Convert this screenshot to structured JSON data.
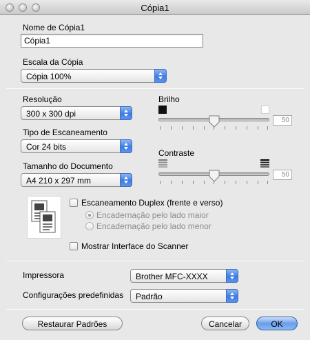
{
  "window": {
    "title": "Cópia1"
  },
  "copy_name": {
    "label": "Nome de Cópia1",
    "value": "Cópia1"
  },
  "scale": {
    "label": "Escala da Cópia",
    "value": "Cópia 100%"
  },
  "resolution": {
    "label": "Resolução",
    "value": "300 x 300 dpi"
  },
  "scan_type": {
    "label": "Tipo de Escaneamento",
    "value": "Cor 24 bits"
  },
  "doc_size": {
    "label": "Tamanho do Documento",
    "value": "A4 210 x 297 mm"
  },
  "brightness": {
    "label": "Brilho",
    "value": "50",
    "level": 50,
    "min": 0,
    "max": 100
  },
  "contrast": {
    "label": "Contraste",
    "value": "50",
    "level": 50,
    "min": 0,
    "max": 100
  },
  "duplex": {
    "label": "Escaneamento Duplex (frente e verso)",
    "checked": false,
    "option_long": "Encadernação pelo lado maior",
    "option_short": "Encadernação pelo lado menor",
    "selected": "option_long"
  },
  "show_interface": {
    "label": "Mostrar Interface do Scanner",
    "checked": false
  },
  "printer": {
    "label": "Impressora",
    "value": "Brother MFC-XXXX"
  },
  "presets": {
    "label": "Configurações predefinidas",
    "value": "Padrão"
  },
  "buttons": {
    "restore": "Restaurar Padrões",
    "cancel": "Cancelar",
    "ok": "OK"
  },
  "colors": {
    "accent": "#3e7ce0",
    "window_bg": "#e8e8e8"
  }
}
